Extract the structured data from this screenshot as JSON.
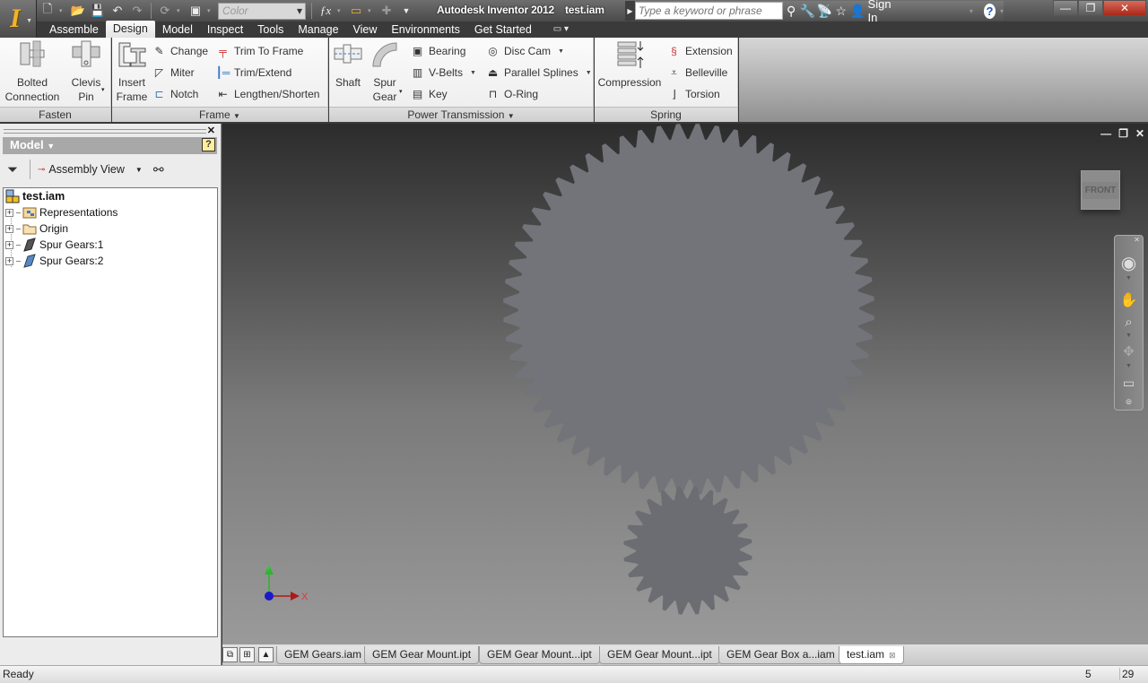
{
  "app": {
    "name": "Autodesk Inventor 2012",
    "document": "test.iam",
    "logo_letter": "I"
  },
  "quick_access": {
    "color_placeholder": "Color",
    "icons": [
      "new-icon",
      "open-icon",
      "save-icon",
      "undo-icon",
      "redo-icon",
      "update-icon",
      "select-icon",
      "fx-icon",
      "measure-icon",
      "add-icon",
      "customize-icon"
    ]
  },
  "infocenter": {
    "search_placeholder": "Type a keyword or phrase",
    "sign_in": "Sign In",
    "help": "?"
  },
  "tabs": [
    {
      "label": "Assemble",
      "active": false
    },
    {
      "label": "Design",
      "active": true
    },
    {
      "label": "Model",
      "active": false
    },
    {
      "label": "Inspect",
      "active": false
    },
    {
      "label": "Tools",
      "active": false
    },
    {
      "label": "Manage",
      "active": false
    },
    {
      "label": "View",
      "active": false
    },
    {
      "label": "Environments",
      "active": false
    },
    {
      "label": "Get Started",
      "active": false
    }
  ],
  "ribbon": {
    "fasten": {
      "title": "Fasten",
      "bolted_1": "Bolted",
      "bolted_2": "Connection",
      "clevis_1": "Clevis",
      "clevis_2": "Pin"
    },
    "frame": {
      "title": "Frame",
      "insert_1": "Insert",
      "insert_2": "Frame",
      "change": "Change",
      "miter": "Miter",
      "notch": "Notch",
      "trim_to_frame": "Trim To Frame",
      "trim_extend": "Trim/Extend",
      "lengthen": "Lengthen/Shorten"
    },
    "power": {
      "title": "Power Transmission",
      "shaft": "Shaft",
      "spur_1": "Spur",
      "spur_2": "Gear",
      "bearing": "Bearing",
      "vbelts": "V-Belts",
      "key": "Key",
      "disc_cam": "Disc Cam",
      "splines": "Parallel Splines",
      "oring": "O-Ring"
    },
    "spring": {
      "title": "Spring",
      "compression": "Compression",
      "extension": "Extension",
      "belleville": "Belleville",
      "torsion": "Torsion"
    }
  },
  "browser": {
    "header": "Model",
    "help": "?",
    "view": "Assembly View",
    "tree": {
      "root": "test.iam",
      "items": [
        "Representations",
        "Origin",
        "Spur Gears:1",
        "Spur Gears:2"
      ]
    }
  },
  "viewport": {
    "viewcube_face": "FRONT",
    "axes": {
      "x": "X",
      "y": "Y"
    },
    "gears": [
      {
        "name": "Spur Gears:1",
        "teeth": 60,
        "color": "#737479"
      },
      {
        "name": "Spur Gears:2",
        "teeth": 24,
        "color": "#6c6d72"
      }
    ]
  },
  "doc_tabs": [
    {
      "label": "GEM Gears.iam",
      "active": false
    },
    {
      "label": "GEM Gear Mount.ipt",
      "active": false
    },
    {
      "label": "GEM Gear Mount...ipt",
      "active": false
    },
    {
      "label": "GEM Gear Mount...ipt",
      "active": false
    },
    {
      "label": "GEM Gear Box a...iam",
      "active": false
    },
    {
      "label": "test.iam",
      "active": true
    }
  ],
  "status": {
    "text": "Ready",
    "value1": "5",
    "value2": "29"
  }
}
